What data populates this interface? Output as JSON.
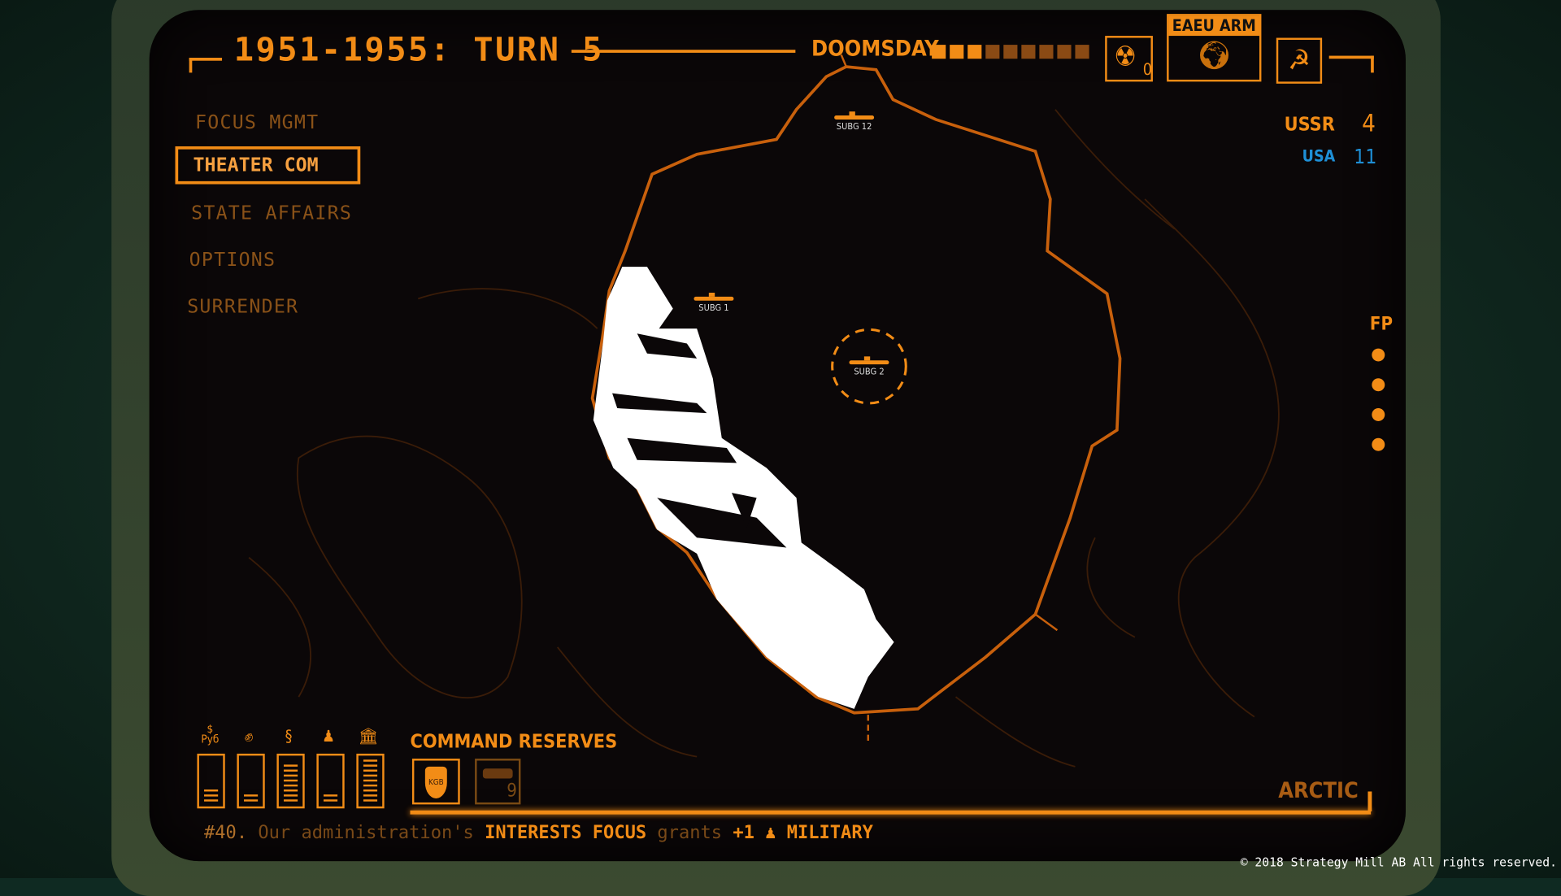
{
  "header": {
    "title": "1951-1955: TURN 5",
    "doomsday_label": "DOOMSDAY",
    "doomsday_level": 3,
    "doomsday_max": 9,
    "nuke_count": "0",
    "region_button": "EAEU ARM"
  },
  "menu": {
    "items": [
      {
        "label": "FOCUS MGMT"
      },
      {
        "label": "THEATER COM",
        "active": true
      },
      {
        "label": "STATE AFFAIRS"
      },
      {
        "label": "OPTIONS"
      },
      {
        "label": "SURRENDER"
      }
    ]
  },
  "scores": {
    "ussr_label": "USSR",
    "ussr_value": "4",
    "usa_label": "USA",
    "usa_value": "11"
  },
  "fp": {
    "label": "FP",
    "count": 4
  },
  "map": {
    "units": [
      {
        "label": "SUBG 12"
      },
      {
        "label": "SUBG 1"
      },
      {
        "label": "SUBG 2",
        "selected": true
      }
    ],
    "region_label": "ARCTIC"
  },
  "resources": {
    "rub_label": "Руб",
    "levels": [
      3,
      2,
      8,
      2,
      9
    ]
  },
  "reserves": {
    "title": "COMMAND RESERVES",
    "kgb_label": "KGB",
    "tank_count": "9"
  },
  "ticker": {
    "num": "#40.",
    "t1": "Our administration's",
    "t2": "INTERESTS FOCUS",
    "t3": "grants",
    "t4": "+1",
    "t5": "MILITARY"
  },
  "footer": {
    "copyright": "© 2018 Strategy Mill AB All rights reserved."
  },
  "colors": {
    "accent": "#f28c16",
    "usa": "#1e8fd6",
    "background": "#0b0708"
  }
}
